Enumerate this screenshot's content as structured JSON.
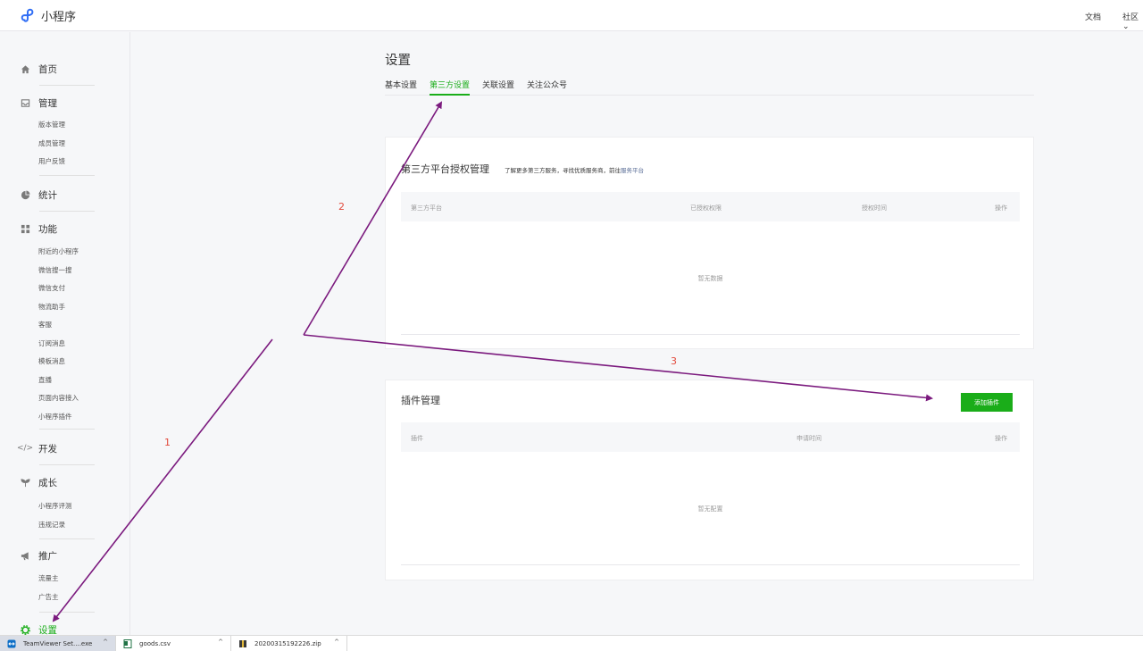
{
  "app": {
    "title": "小程序"
  },
  "topnav": {
    "docs": "文档",
    "community": "社区"
  },
  "sidebar": {
    "home": "首页",
    "manage": {
      "label": "管理",
      "items": [
        "版本管理",
        "成员管理",
        "用户反馈"
      ]
    },
    "stats": "统计",
    "features": {
      "label": "功能",
      "items": [
        "附近的小程序",
        "微信搜一搜",
        "微信支付",
        "物流助手",
        "客服",
        "订阅消息",
        "模板消息",
        "直播",
        "页面内容接入",
        "小程序插件"
      ]
    },
    "dev": "开发",
    "growth": {
      "label": "成长",
      "items": [
        "小程序评测",
        "违规记录"
      ]
    },
    "promo": {
      "label": "推广",
      "items": [
        "流量主",
        "广告主"
      ]
    },
    "settings": "设置"
  },
  "page": {
    "title": "设置",
    "tabs": [
      "基本设置",
      "第三方设置",
      "关联设置",
      "关注公众号"
    ],
    "active_tab": "第三方设置"
  },
  "third_party": {
    "title": "第三方平台授权管理",
    "desc": "了解更多第三方服务，寻找优质服务商，前往",
    "desc_link": "服务平台",
    "columns": [
      "第三方平台",
      "已授权权限",
      "授权时间",
      "操作"
    ],
    "empty": "暂无数据"
  },
  "plugins": {
    "title": "插件管理",
    "add_button": "添加插件",
    "columns": [
      "插件",
      "申请时间",
      "操作"
    ],
    "empty": "暂无配置"
  },
  "annotations": {
    "n1": "1",
    "n2": "2",
    "n3": "3",
    "color": "#7b1a7e"
  },
  "taskbar": {
    "items": [
      {
        "name": "TeamViewer Set....exe"
      },
      {
        "name": "goods.csv"
      },
      {
        "name": "20200315192226.zip"
      }
    ]
  },
  "colors": {
    "accent": "#1aad19",
    "link": "#576b95",
    "annotation_text": "#e24a3c"
  }
}
